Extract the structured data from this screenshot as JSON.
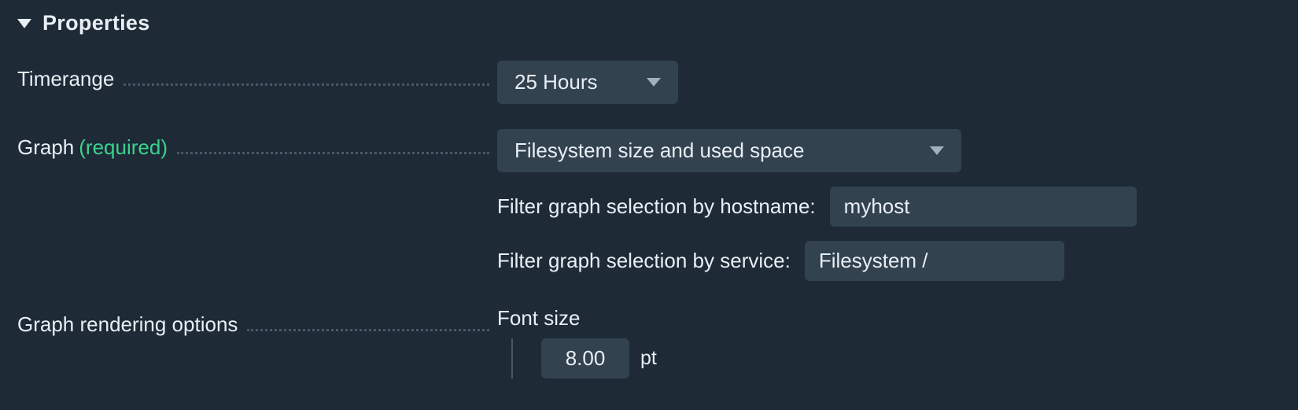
{
  "section": {
    "title": "Properties"
  },
  "labels": {
    "timerange": "Timerange",
    "graph": "Graph",
    "graph_required": "(required)",
    "rendering": "Graph rendering options",
    "filter_hostname": "Filter graph selection by hostname:",
    "filter_service": "Filter graph selection by service:",
    "font_size": "Font size",
    "font_unit": "pt"
  },
  "values": {
    "timerange": "25 Hours",
    "graph": "Filesystem size and used space",
    "hostname": "myhost",
    "service": "Filesystem /",
    "font_size": "8.00"
  }
}
